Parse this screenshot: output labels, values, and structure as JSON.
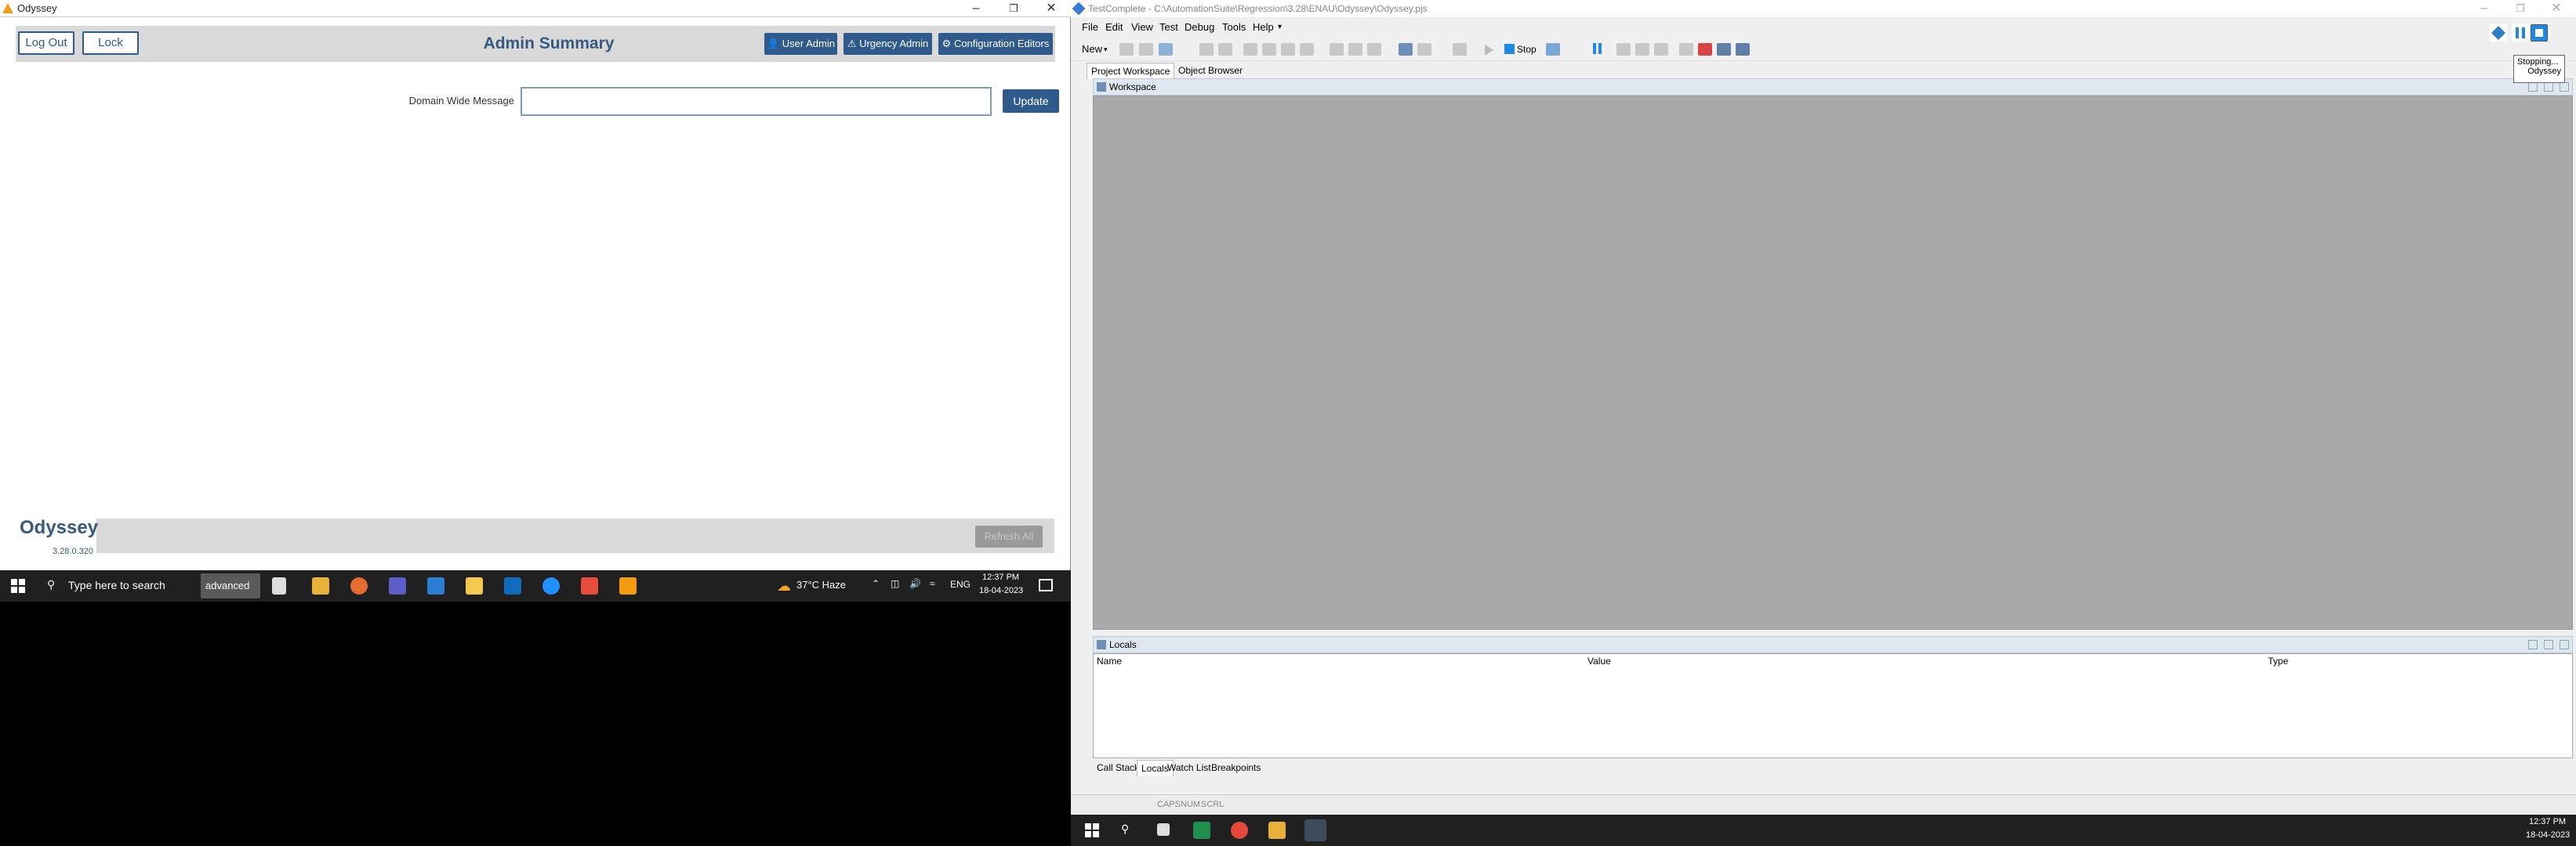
{
  "odyssey": {
    "window_title": "Odyssey",
    "header": {
      "logout_label": "Log Out",
      "lock_label": "Lock",
      "title": "Admin Summary",
      "user_admin_label": "User Admin",
      "urgency_admin_label": "Urgency Admin",
      "config_editors_label": "Configuration Editors"
    },
    "form": {
      "domain_message_label": "Domain Wide Message",
      "domain_message_value": "",
      "update_label": "Update"
    },
    "footer": {
      "brand": "Odyssey",
      "version": "3.28.0.320",
      "refresh_all_label": "Refresh All"
    }
  },
  "taskbar_left": {
    "search_placeholder": "Type here to search",
    "advanced_label": "advanced",
    "weather": "37°C  Haze",
    "language": "ENG",
    "time": "12:37 PM",
    "date": "18-04-2023"
  },
  "testcomplete": {
    "window_title": "TestComplete - C:\\AutomationSuite\\Regression\\3.28\\ENAU\\Odyssey\\Odyssey.pjs",
    "menu": [
      "File",
      "Edit",
      "View",
      "Test",
      "Debug",
      "Tools",
      "Help"
    ],
    "toolbar": {
      "new_label": "New",
      "stop_label": "Stop"
    },
    "tabs": [
      "Project Workspace",
      "Object Browser"
    ],
    "workspace_title": "Workspace",
    "locals_title": "Locals",
    "locals_columns": [
      "Name",
      "Value",
      "Type"
    ],
    "bottom_tabs": [
      "Call Stack",
      "Locals",
      "Watch List",
      "Breakpoints"
    ],
    "status": [
      "CAPS",
      "NUM",
      "SCRL"
    ],
    "tooltip": {
      "line1": "Stopping...",
      "line2": "Odyssey"
    }
  },
  "taskbar_right": {
    "time": "12:37 PM",
    "date": "18-04-2023"
  },
  "colors": {
    "brand_blue": "#2e5b8c",
    "workspace_gray": "#a9a9a9",
    "taskbar": "#202020"
  }
}
